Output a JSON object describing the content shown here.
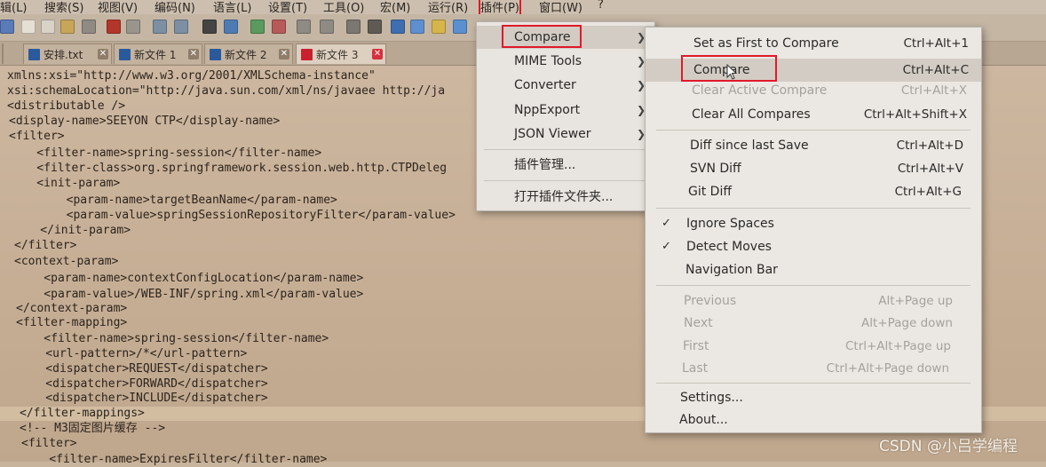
{
  "menubar": {
    "items": [
      "辑(L)",
      "搜索(S)",
      "视图(V)",
      "编码(N)",
      "语言(L)",
      "设置(T)",
      "工具(O)",
      "宏(M)",
      "运行(R)",
      "插件(P)",
      "窗口(W)",
      "?"
    ]
  },
  "tabs": [
    {
      "label": "安排.txt",
      "active": false
    },
    {
      "label": "新文件 1",
      "active": false
    },
    {
      "label": "新文件 2",
      "active": false
    },
    {
      "label": "新文件 3",
      "active": true
    }
  ],
  "editor": {
    "lines": [
      "xmlns:xsi=\"http://www.w3.org/2001/XMLSchema-instance\"",
      "xsi:schemaLocation=\"http://java.sun.com/xml/ns/javaee http://ja",
      "<distributable />",
      "<display-name>SEEYON CTP</display-name>",
      "<filter>",
      "    <filter-name>spring-session</filter-name>",
      "    <filter-class>org.springframework.session.web.http.CTPDeleg",
      "    <init-param>",
      "        <param-name>targetBeanName</param-name>",
      "        <param-value>springSessionRepositoryFilter</param-value>",
      "    </init-param>",
      "</filter>",
      "<context-param>",
      "    <param-name>contextConfigLocation</param-name>",
      "    <param-value>/WEB-INF/spring.xml</param-value>",
      "</context-param>",
      "<filter-mapping>",
      "    <filter-name>spring-session</filter-name>",
      "    <url-pattern>/*</url-pattern>",
      "    <dispatcher>REQUEST</dispatcher>",
      "    <dispatcher>FORWARD</dispatcher>",
      "    <dispatcher>INCLUDE</dispatcher>",
      "</filter-mappings>",
      "<!-- M3固定图片缓存 -->",
      "<filter>",
      "    <filter-name>ExpiresFilter</filter-name>"
    ]
  },
  "plugins_menu": {
    "items": [
      {
        "label": "Compare",
        "submenu": true
      },
      {
        "label": "MIME Tools",
        "submenu": true
      },
      {
        "label": "Converter",
        "submenu": true
      },
      {
        "label": "NppExport",
        "submenu": true
      },
      {
        "label": "JSON Viewer",
        "submenu": true
      },
      {
        "label": "插件管理...",
        "submenu": false
      },
      {
        "label": "打开插件文件夹...",
        "submenu": false
      }
    ]
  },
  "compare_menu": {
    "items": [
      {
        "label": "Set as First to Compare",
        "shortcut": "Ctrl+Alt+1",
        "enabled": true
      },
      {
        "label": "Compare",
        "shortcut": "Ctrl+Alt+C",
        "enabled": true
      },
      {
        "label": "Clear Active Compare",
        "shortcut": "Ctrl+Alt+X",
        "enabled": false
      },
      {
        "label": "Clear All Compares",
        "shortcut": "Ctrl+Alt+Shift+X",
        "enabled": true
      },
      {
        "label": "Diff since last Save",
        "shortcut": "Ctrl+Alt+D",
        "enabled": true
      },
      {
        "label": "SVN Diff",
        "shortcut": "Ctrl+Alt+V",
        "enabled": true
      },
      {
        "label": "Git Diff",
        "shortcut": "Ctrl+Alt+G",
        "enabled": true
      },
      {
        "label": "Ignore Spaces",
        "shortcut": "",
        "enabled": true,
        "checked": true
      },
      {
        "label": "Detect Moves",
        "shortcut": "",
        "enabled": true,
        "checked": true
      },
      {
        "label": "Navigation Bar",
        "shortcut": "",
        "enabled": true
      },
      {
        "label": "Previous",
        "shortcut": "Alt+Page up",
        "enabled": false
      },
      {
        "label": "Next",
        "shortcut": "Alt+Page down",
        "enabled": false
      },
      {
        "label": "First",
        "shortcut": "Ctrl+Alt+Page up",
        "enabled": false
      },
      {
        "label": "Last",
        "shortcut": "Ctrl+Alt+Page down",
        "enabled": false
      },
      {
        "label": "Settings...",
        "shortcut": "",
        "enabled": true
      },
      {
        "label": "About...",
        "shortcut": "",
        "enabled": true
      }
    ]
  },
  "watermark": "CSDN @小吕学编程",
  "colors": {
    "highlight_box": "#e0192a",
    "active_tab_close": "#d6303c"
  }
}
